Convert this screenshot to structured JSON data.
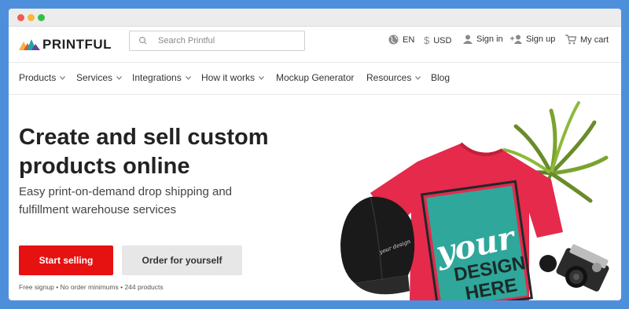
{
  "window": {
    "controls": [
      "close",
      "minimize",
      "maximize"
    ]
  },
  "header": {
    "logo_text": "PRINTFUL",
    "search_placeholder": "Search Printful",
    "language": "EN",
    "currency": "USD",
    "sign_in": "Sign in",
    "sign_up": "Sign up",
    "cart": "My cart"
  },
  "nav": {
    "items": [
      {
        "label": "Products",
        "dropdown": true
      },
      {
        "label": "Services",
        "dropdown": true
      },
      {
        "label": "Integrations",
        "dropdown": true
      },
      {
        "label": "How it works",
        "dropdown": true
      },
      {
        "label": "Mockup Generator",
        "dropdown": false
      },
      {
        "label": "Resources",
        "dropdown": true
      },
      {
        "label": "Blog",
        "dropdown": false
      }
    ]
  },
  "hero": {
    "title": "Create and sell custom products online",
    "subtitle": "Easy print-on-demand drop shipping and fulfillment warehouse services",
    "primary_cta": "Start selling",
    "secondary_cta": "Order for yourself",
    "fine_print": "Free signup • No order minimums • 244 products",
    "shirt_text_line1": "your",
    "shirt_text_line2": "DESIGN",
    "shirt_text_line3": "HERE"
  },
  "colors": {
    "page_background": "#4e8fdc",
    "accent_red": "#e61212",
    "shirt_red": "#e52a4b",
    "design_teal": "#2fa79a"
  },
  "icons": [
    "search-icon",
    "globe-icon",
    "dollar-icon",
    "user-icon",
    "user-add-icon",
    "cart-icon",
    "chevron-down-icon"
  ]
}
